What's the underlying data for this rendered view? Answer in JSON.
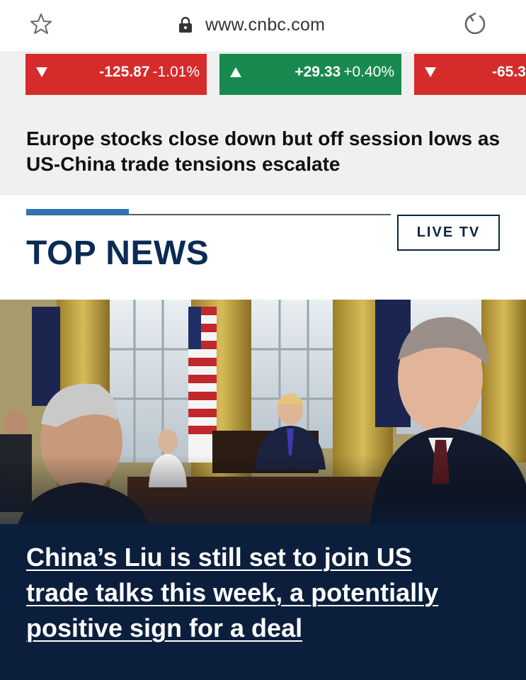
{
  "browser": {
    "url": "www.cnbc.com",
    "icons": {
      "bookmark": "star-icon",
      "secure": "lock-icon",
      "reload": "reload-icon"
    }
  },
  "ticker": {
    "items": [
      {
        "direction": "down",
        "change": "-125.87",
        "percent": "-1.01%",
        "color": "#d62b2b"
      },
      {
        "direction": "up",
        "change": "+29.33",
        "percent": "+0.40%",
        "color": "#198a4f"
      },
      {
        "direction": "down",
        "change": "-65.3",
        "percent": "",
        "color": "#d62b2b"
      }
    ]
  },
  "feature_headline": "Europe stocks close down but off session lows as US-China trade tensions escalate",
  "section": {
    "title": "TOP NEWS",
    "live_tv_label": "LIVE TV",
    "accent_color": "#2d74b8",
    "title_color": "#0b2b55"
  },
  "top_story": {
    "headline": "China’s Liu is still set to join US trade talks this week, a potentially positive sign for a deal"
  }
}
